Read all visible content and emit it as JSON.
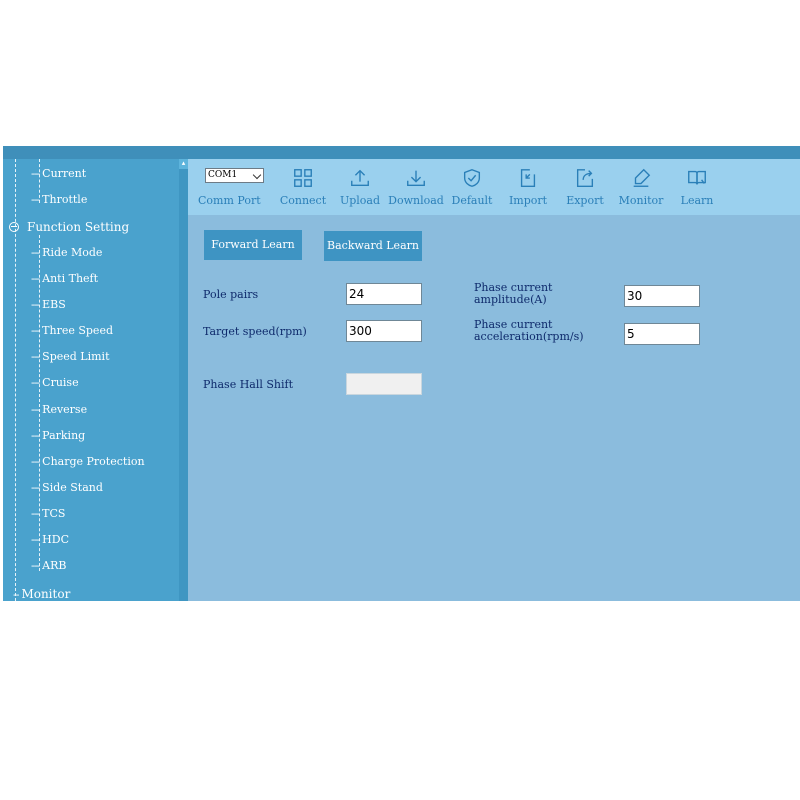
{
  "sidebar": {
    "items_top": [
      {
        "label": "Current"
      },
      {
        "label": "Throttle"
      }
    ],
    "group": {
      "label": "Function Setting"
    },
    "items": [
      {
        "label": "Ride Mode"
      },
      {
        "label": "Anti Theft"
      },
      {
        "label": "EBS"
      },
      {
        "label": "Three Speed"
      },
      {
        "label": "Speed Limit"
      },
      {
        "label": "Cruise"
      },
      {
        "label": "Reverse"
      },
      {
        "label": "Parking"
      },
      {
        "label": "Charge Protection"
      },
      {
        "label": "Side Stand"
      },
      {
        "label": "TCS"
      },
      {
        "label": "HDC"
      },
      {
        "label": "ARB"
      }
    ],
    "monitor": {
      "label": "Monitor"
    }
  },
  "toolbar": {
    "com_port": {
      "value": "COM1",
      "label": "Comm Port"
    },
    "buttons": [
      {
        "label": "Connect",
        "icon": "connect-icon"
      },
      {
        "label": "Upload",
        "icon": "upload-icon"
      },
      {
        "label": "Download",
        "icon": "download-icon"
      },
      {
        "label": "Default",
        "icon": "shield-check-icon"
      },
      {
        "label": "Import",
        "icon": "import-icon"
      },
      {
        "label": "Export",
        "icon": "export-icon"
      },
      {
        "label": "Monitor",
        "icon": "pen-icon"
      },
      {
        "label": "Learn",
        "icon": "book-icon"
      }
    ]
  },
  "learn": {
    "forward_label": "Forward Learn",
    "backward_label": "Backward Learn",
    "pole_pairs": {
      "label": "Pole pairs",
      "value": "24"
    },
    "target_speed": {
      "label": "Target speed(rpm)",
      "value": "300"
    },
    "phase_current_amplitude": {
      "label_line1": "Phase current",
      "label_line2": "amplitude(A)",
      "value": "30"
    },
    "phase_current_acceleration": {
      "label_line1": "Phase current",
      "label_line2": "acceleration(rpm/s)",
      "value": "5"
    },
    "phase_hall_shift": {
      "label": "Phase Hall Shift",
      "value": ""
    }
  },
  "colors": {
    "sidebar_bg": "#4aa2cd",
    "toolbar_bg": "#9ad0ee",
    "content_bg": "#8bbcdd",
    "button_bg": "#3e94c3",
    "toolbar_text": "#2a7fb8",
    "label_text": "#0e2a6b"
  }
}
